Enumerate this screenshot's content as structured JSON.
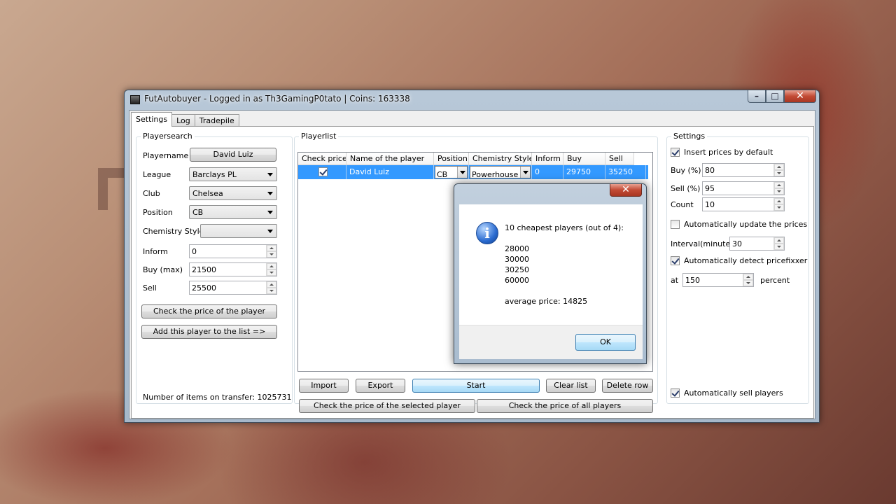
{
  "window": {
    "title": "FutAutobuyer - Logged in as Th3GamingP0tato | Coins: 163338"
  },
  "tabs": [
    "Settings",
    "Log",
    "Tradepile"
  ],
  "playersearch": {
    "title": "Playersearch",
    "playername_label": "Playername",
    "playername_value": "David Luiz",
    "league_label": "League",
    "league_value": "Barclays PL",
    "club_label": "Club",
    "club_value": "Chelsea",
    "position_label": "Position",
    "position_value": "CB",
    "chemistry_label": "Chemistry Style",
    "chemistry_value": "",
    "inform_label": "Inform",
    "inform_value": "0",
    "buy_label": "Buy (max)",
    "buy_value": "21500",
    "sell_label": "Sell",
    "sell_value": "25500",
    "check_price_button": "Check the price of the player",
    "add_player_button": "Add this player to the list =>",
    "items_on_transfer": "Number of items on transfer: 1025731"
  },
  "playerlist": {
    "title": "Playerlist",
    "columns": [
      "Check price",
      "Name of the player",
      "Position",
      "Chemistry Style",
      "Inform",
      "Buy",
      "Sell"
    ],
    "rows": [
      {
        "check": true,
        "name": "David Luiz",
        "position": "CB",
        "chemistry": "Powerhouse",
        "inform": "0",
        "buy": "29750",
        "sell": "35250"
      }
    ],
    "buttons": {
      "import": "Import",
      "export": "Export",
      "start": "Start",
      "clear": "Clear list",
      "delete": "Delete row",
      "check_selected": "Check the price of the selected player",
      "check_all": "Check the price of all players"
    }
  },
  "settings": {
    "title": "Settings",
    "insert_prices": "Insert prices by default",
    "insert_prices_checked": true,
    "buy_label": "Buy (%)",
    "buy_value": "80",
    "sell_label": "Sell (%)",
    "sell_value": "95",
    "count_label": "Count",
    "count_value": "10",
    "auto_update": "Automatically update the prices",
    "auto_update_checked": false,
    "interval_label": "Interval(minutes)",
    "interval_value": "30",
    "auto_detect": "Automatically detect pricefixxer",
    "auto_detect_checked": true,
    "at_label": "at",
    "at_value": "150",
    "percent_label": "percent",
    "auto_sell": "Automatically sell players",
    "auto_sell_checked": true
  },
  "dialog": {
    "heading": "10 cheapest players (out of 4):",
    "prices": [
      "28000",
      "30000",
      "30250",
      "60000"
    ],
    "average": "average price: 14825",
    "ok": "OK"
  }
}
